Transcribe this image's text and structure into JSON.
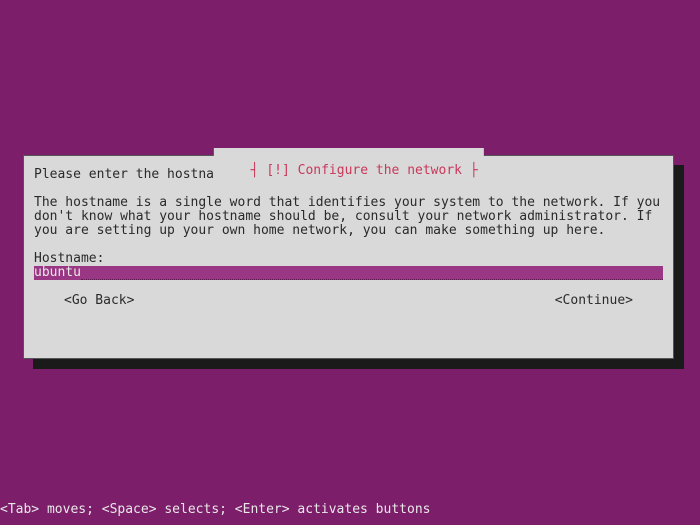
{
  "dialog": {
    "title": "[!] Configure the network",
    "intro": "Please enter the hostname for this system.",
    "description": "The hostname is a single word that identifies your system to the network. If you don't know what your hostname should be, consult your network administrator. If you are setting up your own home network, you can make something up here.",
    "field_label": "Hostname:",
    "hostname_value": "ubuntu",
    "go_back_label": "<Go Back>",
    "continue_label": "<Continue>"
  },
  "footer": {
    "help_text": "<Tab> moves; <Space> selects; <Enter> activates buttons"
  }
}
